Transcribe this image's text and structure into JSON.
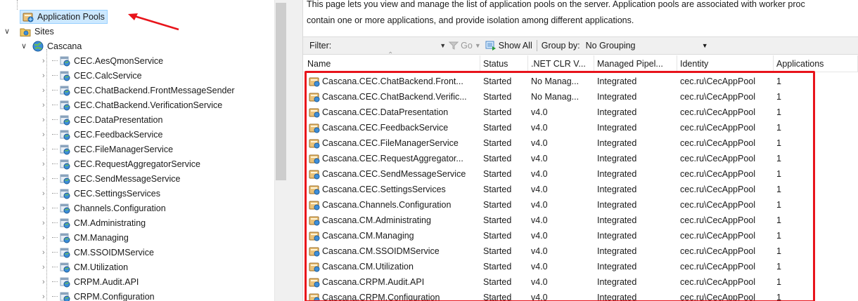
{
  "tree": {
    "app_pools_label": "Application Pools",
    "sites_label": "Sites",
    "site_label": "Cascana",
    "apps": [
      "CEC.AesQmonService",
      "CEC.CalcService",
      "CEC.ChatBackend.FrontMessageSender",
      "CEC.ChatBackend.VerificationService",
      "CEC.DataPresentation",
      "CEC.FeedbackService",
      "CEC.FileManagerService",
      "CEC.RequestAggregatorService",
      "CEC.SendMessageService",
      "CEC.SettingsServices",
      "Channels.Configuration",
      "CM.Administrating",
      "CM.Managing",
      "CM.SSOIDMService",
      "CM.Utilization",
      "CRPM.Audit.API",
      "CRPM.Configuration"
    ]
  },
  "description": {
    "line1": "This page lets you view and manage the list of application pools on the server. Application pools are associated with worker proc",
    "line2": "contain one or more applications, and provide isolation among different applications."
  },
  "filterbar": {
    "filter_label": "Filter:",
    "filter_value": "",
    "go_label": "Go",
    "show_all_label": "Show All",
    "group_by_label": "Group by:",
    "group_by_value": "No Grouping"
  },
  "grid": {
    "columns": [
      "Name",
      "Status",
      ".NET CLR V...",
      "Managed Pipel...",
      "Identity",
      "Applications"
    ],
    "rows": [
      [
        "Cascana.CEC.ChatBackend.Front...",
        "Started",
        "No Manag...",
        "Integrated",
        "cec.ru\\CecAppPool",
        "1"
      ],
      [
        "Cascana.CEC.ChatBackend.Verific...",
        "Started",
        "No Manag...",
        "Integrated",
        "cec.ru\\CecAppPool",
        "1"
      ],
      [
        "Cascana.CEC.DataPresentation",
        "Started",
        "v4.0",
        "Integrated",
        "cec.ru\\CecAppPool",
        "1"
      ],
      [
        "Cascana.CEC.FeedbackService",
        "Started",
        "v4.0",
        "Integrated",
        "cec.ru\\CecAppPool",
        "1"
      ],
      [
        "Cascana.CEC.FileManagerService",
        "Started",
        "v4.0",
        "Integrated",
        "cec.ru\\CecAppPool",
        "1"
      ],
      [
        "Cascana.CEC.RequestAggregator...",
        "Started",
        "v4.0",
        "Integrated",
        "cec.ru\\CecAppPool",
        "1"
      ],
      [
        "Cascana.CEC.SendMessageService",
        "Started",
        "v4.0",
        "Integrated",
        "cec.ru\\CecAppPool",
        "1"
      ],
      [
        "Cascana.CEC.SettingsServices",
        "Started",
        "v4.0",
        "Integrated",
        "cec.ru\\CecAppPool",
        "1"
      ],
      [
        "Cascana.Channels.Configuration",
        "Started",
        "v4.0",
        "Integrated",
        "cec.ru\\CecAppPool",
        "1"
      ],
      [
        "Cascana.CM.Administrating",
        "Started",
        "v4.0",
        "Integrated",
        "cec.ru\\CecAppPool",
        "1"
      ],
      [
        "Cascana.CM.Managing",
        "Started",
        "v4.0",
        "Integrated",
        "cec.ru\\CecAppPool",
        "1"
      ],
      [
        "Cascana.CM.SSOIDMService",
        "Started",
        "v4.0",
        "Integrated",
        "cec.ru\\CecAppPool",
        "1"
      ],
      [
        "Cascana.CM.Utilization",
        "Started",
        "v4.0",
        "Integrated",
        "cec.ru\\CecAppPool",
        "1"
      ],
      [
        "Cascana.CRPM.Audit.API",
        "Started",
        "v4.0",
        "Integrated",
        "cec.ru\\CecAppPool",
        "1"
      ],
      [
        "Cascana.CRPM.Configuration",
        "Started",
        "v4.0",
        "Integrated",
        "cec.ru\\CecAppPool",
        "1"
      ]
    ]
  },
  "colors": {
    "annotation_red": "#e8141b",
    "selection_bg": "#cce8ff"
  },
  "icons": {
    "app_pool": "app-pool-icon",
    "sites": "sites-folder-icon",
    "site": "globe-icon",
    "app": "web-application-icon"
  }
}
